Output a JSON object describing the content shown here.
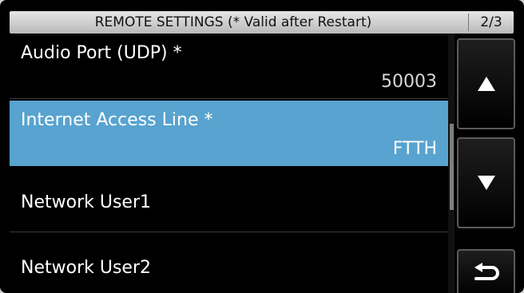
{
  "title_bar": {
    "title": "REMOTE SETTINGS (* Valid after Restart)",
    "page_indicator": "2/3"
  },
  "items": [
    {
      "label": "Audio Port (UDP) *",
      "value": "50003",
      "selected": false
    },
    {
      "label": "Internet Access Line *",
      "value": "FTTH",
      "selected": true
    },
    {
      "label": "Network User1",
      "value": "",
      "selected": false
    },
    {
      "label": "Network User2",
      "value": "",
      "selected": false
    }
  ],
  "scrollbar": {
    "position_fraction": 0.35
  },
  "buttons": {
    "up_icon": "triangle-up-icon",
    "down_icon": "triangle-down-icon",
    "back_icon": "return-arrow-icon"
  }
}
